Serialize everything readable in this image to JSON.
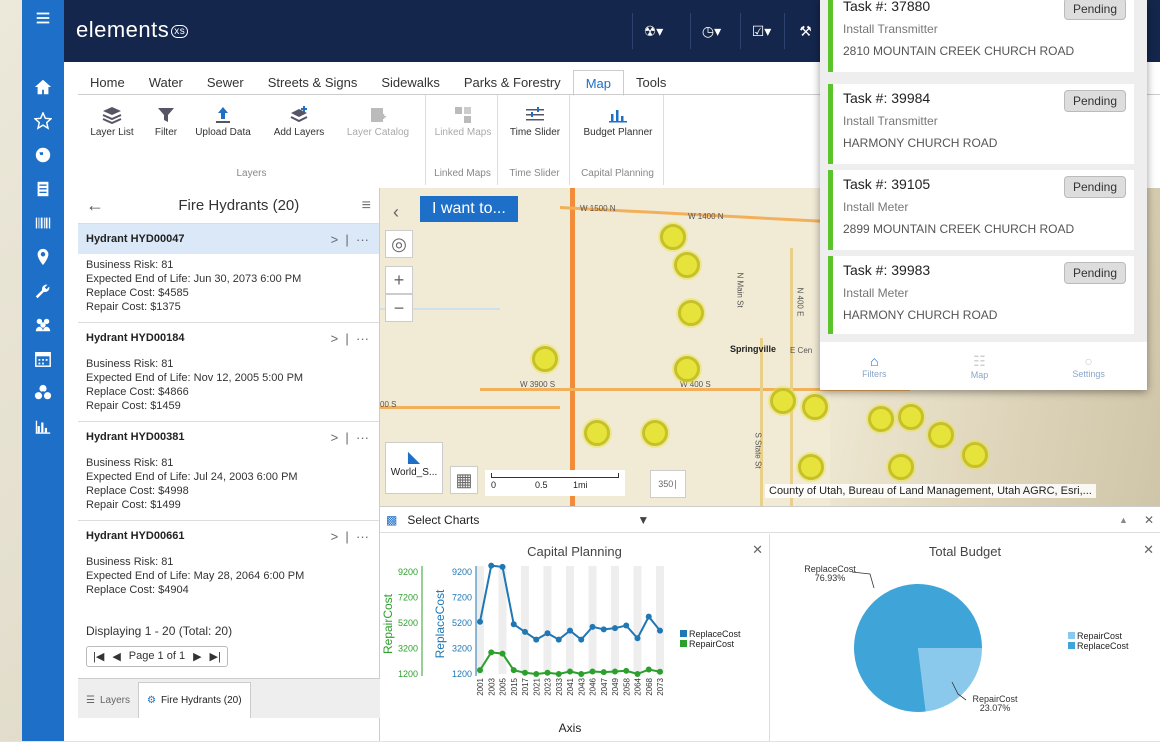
{
  "app": {
    "logo": "elements",
    "logo_badge": "xs"
  },
  "sidebar": [
    "menu-icon",
    "home-icon",
    "star-icon",
    "globe-icon",
    "document-icon",
    "barcode-icon",
    "location-pin-icon",
    "wrench-icon",
    "group-icon",
    "calendar-icon",
    "biohazard-icon",
    "chart-icon"
  ],
  "topbar": {
    "buttons": [
      "biohazard-dropdown",
      "clock-dropdown",
      "checklist-dropdown",
      "wrench-dropdown"
    ]
  },
  "tabs": [
    "Home",
    "Water",
    "Sewer",
    "Streets & Signs",
    "Sidewalks",
    "Parks & Forestry",
    "Map",
    "Tools"
  ],
  "active_tab": "Map",
  "ribbon": {
    "layers": {
      "label": "Layers",
      "buttons": [
        "Layer List",
        "Filter",
        "Upload Data",
        "Add Layers",
        "Layer Catalog"
      ]
    },
    "linked": {
      "label": "Linked Maps",
      "buttons": [
        "Linked Maps"
      ]
    },
    "time": {
      "label": "Time Slider",
      "buttons": [
        "Time Slider"
      ]
    },
    "capital": {
      "label": "Capital Planning",
      "buttons": [
        "Budget Planner"
      ]
    }
  },
  "panel": {
    "title": "Fire Hydrants (20)",
    "items": [
      {
        "name": "Hydrant HYD00047",
        "risk": "Business Risk: 81",
        "eol": "Expected End of Life: Jun 30, 2073 6:00 PM",
        "replace": "Replace Cost: $4585",
        "repair": "Repair Cost: $1375"
      },
      {
        "name": "Hydrant HYD00184",
        "risk": "Business Risk: 81",
        "eol": "Expected End of Life: Nov 12, 2005 5:00 PM",
        "replace": "Replace Cost: $4866",
        "repair": "Repair Cost: $1459"
      },
      {
        "name": "Hydrant HYD00381",
        "risk": "Business Risk: 81",
        "eol": "Expected End of Life: Jul 24, 2003 6:00 PM",
        "replace": "Replace Cost: $4998",
        "repair": "Repair Cost: $1499"
      },
      {
        "name": "Hydrant HYD00661",
        "risk": "Business Risk: 81",
        "eol": "Expected End of Life: May 28, 2064 6:00 PM",
        "replace": "Replace Cost: $4904",
        "repair": ""
      }
    ],
    "displaying": "Displaying 1 - 20 (Total: 20)",
    "page": "Page 1 of 1",
    "tab_layers": "Layers",
    "tab_hydrants": "Fire Hydrants (20)"
  },
  "map": {
    "iwant": "I want to...",
    "attribution": "County of Utah, Bureau of Land Management, Utah AGRC, Esri,...",
    "basemap": "World_S...",
    "scale": [
      "0",
      "0.5",
      "1mi"
    ],
    "labels": [
      "W 1500 N",
      "W 1400 N",
      "Springville",
      "W 3900 S",
      "W 400 S",
      "N Main St",
      "E Cen",
      "00 S",
      "N 400 E",
      "S State St"
    ]
  },
  "charts": {
    "selector": "Select Charts",
    "cp": {
      "title": "Capital Planning",
      "ylabel_left": "RepairCost",
      "ylabel_right": "ReplaceCost",
      "xlabel": "Axis"
    },
    "tb": {
      "title": "Total Budget"
    }
  },
  "chart_data": [
    {
      "type": "line",
      "title": "Capital Planning",
      "xlabel": "Axis",
      "ylabel": "RepairCost / ReplaceCost",
      "categories": [
        "2001",
        "2003",
        "2005",
        "2015",
        "2017",
        "2021",
        "2023",
        "2033",
        "2041",
        "2043",
        "2046",
        "2047",
        "2049",
        "2058",
        "2064",
        "2068",
        "2073"
      ],
      "yticks": [
        1200,
        3200,
        5200,
        7200,
        9200
      ],
      "series": [
        {
          "name": "ReplaceCost",
          "color": "#1f77b4",
          "values": [
            5300,
            9700,
            9600,
            5100,
            4500,
            3900,
            4400,
            3900,
            4600,
            3900,
            4900,
            4700,
            4800,
            5000,
            4000,
            5700,
            4600
          ]
        },
        {
          "name": "RepairCost",
          "color": "#2ca02c",
          "values": [
            1500,
            2900,
            2800,
            1500,
            1300,
            1200,
            1300,
            1200,
            1400,
            1200,
            1400,
            1350,
            1400,
            1450,
            1200,
            1550,
            1375
          ]
        }
      ]
    },
    {
      "type": "pie",
      "title": "Total Budget",
      "slices": [
        {
          "name": "ReplaceCost",
          "value": 76.93,
          "label": "ReplaceCost",
          "pct": "76.93%",
          "color": "#3fa4d8"
        },
        {
          "name": "RepairCost",
          "value": 23.07,
          "label": "RepairCost",
          "pct": "23.07%",
          "color": "#8ac8ec"
        }
      ],
      "legend": [
        "RepairCost",
        "ReplaceCost"
      ]
    }
  ],
  "tasks": [
    {
      "num": "Task #: 37880",
      "status": "Pending",
      "desc": "Install Transmitter",
      "addr": "2810 MOUNTAIN CREEK CHURCH ROAD"
    },
    {
      "num": "Task #: 39984",
      "status": "Pending",
      "desc": "Install Transmitter",
      "addr": "HARMONY CHURCH ROAD"
    },
    {
      "num": "Task #: 39105",
      "status": "Pending",
      "desc": "Install Meter",
      "addr": "2899 MOUNTAIN CREEK CHURCH ROAD"
    },
    {
      "num": "Task #: 39983",
      "status": "Pending",
      "desc": "Install Meter",
      "addr": "HARMONY CHURCH ROAD"
    }
  ],
  "task_footer": [
    "Filters",
    "Map",
    "Settings"
  ]
}
